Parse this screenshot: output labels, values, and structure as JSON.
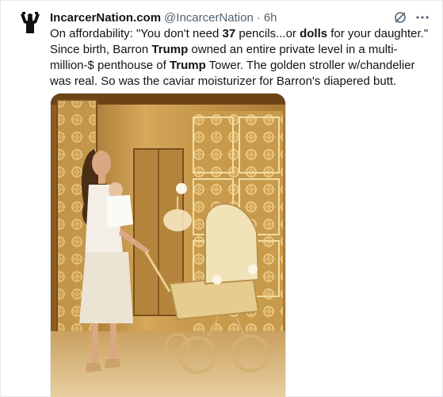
{
  "tweet": {
    "display_name": "IncarcerNation.com",
    "handle": "@IncarcerNation",
    "separator": "·",
    "time": "6h",
    "text_segments": [
      {
        "t": "On affordability: \"You don't need ",
        "b": false
      },
      {
        "t": "37",
        "b": true
      },
      {
        "t": " pencils...or ",
        "b": false
      },
      {
        "t": "dolls",
        "b": true
      },
      {
        "t": " for your daughter.\" Since birth, Barron ",
        "b": false
      },
      {
        "t": "Trump",
        "b": true
      },
      {
        "t": " owned an entire private level in a multi-million-$ penthouse of ",
        "b": false
      },
      {
        "t": "Trump",
        "b": true
      },
      {
        "t": " Tower. The golden stroller w/chandelier was real. So was the caviar moisturizer for Barron's diapered butt.",
        "b": false
      }
    ]
  },
  "icons": {
    "avatar": "avatar-figure-icon",
    "grok": "grok-slash-icon",
    "more": "more-options-icon"
  },
  "colors": {
    "text": "#0f1419",
    "secondary": "#536471",
    "border": "#e6e9ec",
    "gold": "#b98a3a"
  }
}
